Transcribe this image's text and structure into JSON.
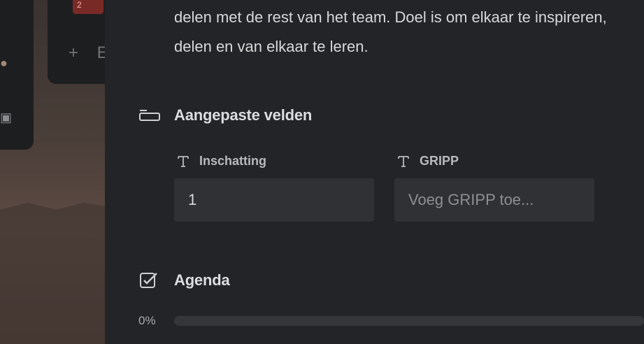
{
  "background_board": {
    "tag_text": "2",
    "add_label": "+ E"
  },
  "card": {
    "description_lines": [
      "delen met de rest van het team.  Doel is om elkaar te inspireren,",
      "delen en van elkaar te leren."
    ],
    "custom_fields": {
      "title": "Aangepaste velden",
      "fields": [
        {
          "label": "Inschatting",
          "value": "1",
          "placeholder": ""
        },
        {
          "label": "GRIPP",
          "value": "",
          "placeholder": "Voeg GRIPP toe..."
        }
      ]
    },
    "checklist": {
      "title": "Agenda",
      "progress_text": "0%",
      "progress": 0
    }
  },
  "colors": {
    "panel_bg": "#232427",
    "field_bg": "#303134",
    "progress_track": "#35363a"
  }
}
